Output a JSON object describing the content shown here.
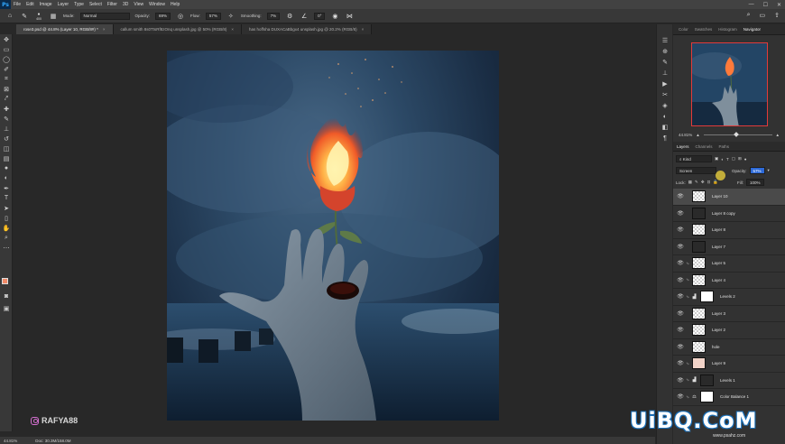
{
  "menu": {
    "logo": "Ps",
    "items": [
      "File",
      "Edit",
      "Image",
      "Layer",
      "Type",
      "Select",
      "Filter",
      "3D",
      "View",
      "Window",
      "Help"
    ]
  },
  "options": {
    "brush_size": "400",
    "mode_label": "Mode:",
    "mode_value": "Normal",
    "opacity_label": "Opacity:",
    "opacity_value": "69%",
    "flow_label": "Flow:",
    "flow_value": "57%",
    "smoothing_label": "Smoothing:",
    "smoothing_value": "7%",
    "angle_value": "0°"
  },
  "tabs": [
    {
      "label": "rose3.psd @ 44.8% (Layer 10, RGB/8#) *",
      "close": "×"
    },
    {
      "label": "callum smith 8s0TtsRf8zOnq unsplash.jpg @ 50% (RGB/8)",
      "close": "×"
    },
    {
      "label": "has hoffsha DUXACaBbgx4 unsplash.jpg @ 20.2% (RGB/8)",
      "close": "×"
    }
  ],
  "panel_tabs": [
    "Color",
    "Swatches",
    "Histogram",
    "Navigator"
  ],
  "navigator": {
    "zoom": "44.81%"
  },
  "layers_tabs": [
    "Layers",
    "Channels",
    "Paths"
  ],
  "layers_controls": {
    "filter_kind": "Kind",
    "blend_mode": "Screen",
    "opacity_label": "Opacity:",
    "opacity_value": "57%",
    "lock_label": "Lock:",
    "fill_label": "Fill:",
    "fill_value": "100%"
  },
  "layers": [
    {
      "name": "Layer 10",
      "thumb": "trans",
      "selected": true,
      "clip": false,
      "adj": "",
      "mask": false
    },
    {
      "name": "Layer 8 copy",
      "thumb": "dark",
      "selected": false,
      "clip": false,
      "adj": "",
      "mask": false
    },
    {
      "name": "Layer 8",
      "thumb": "trans",
      "selected": false,
      "clip": false,
      "adj": "",
      "mask": false
    },
    {
      "name": "Layer 7",
      "thumb": "dark",
      "selected": false,
      "clip": false,
      "adj": "",
      "mask": false
    },
    {
      "name": "Layer 5",
      "thumb": "trans",
      "selected": false,
      "clip": true,
      "adj": "",
      "mask": false
    },
    {
      "name": "Layer 4",
      "thumb": "trans",
      "selected": false,
      "clip": true,
      "adj": "",
      "mask": false
    },
    {
      "name": "Levels 2",
      "thumb": "mask-white",
      "selected": false,
      "clip": true,
      "adj": "levels",
      "mask": true
    },
    {
      "name": "Layer 3",
      "thumb": "trans",
      "selected": false,
      "clip": false,
      "adj": "",
      "mask": false
    },
    {
      "name": "Layer 2",
      "thumb": "trans",
      "selected": false,
      "clip": false,
      "adj": "",
      "mask": false
    },
    {
      "name": "hole",
      "thumb": "trans",
      "selected": false,
      "clip": false,
      "adj": "",
      "mask": false
    },
    {
      "name": "Layer 9",
      "thumb": "pink",
      "selected": false,
      "clip": true,
      "adj": "",
      "mask": false
    },
    {
      "name": "Levels 1",
      "thumb": "dark",
      "selected": false,
      "clip": true,
      "adj": "levels",
      "mask": true
    },
    {
      "name": "Color Balance 1",
      "thumb": "mask-white",
      "selected": false,
      "clip": true,
      "adj": "balance",
      "mask": true
    }
  ],
  "status": {
    "zoom": "44.81%",
    "doc": "Doc: 30.3M/158.0M"
  },
  "watermarks": {
    "instagram": "RAFYA88",
    "site": "UiBQ.CoM",
    "site_sub": "www.psahz.com"
  },
  "colors": {
    "foreground": "#f08a68",
    "background": "#ffffff",
    "accent": "#2d6ad8"
  }
}
